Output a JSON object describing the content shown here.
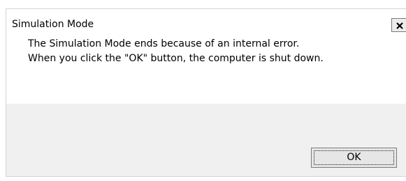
{
  "dialog": {
    "title": "Simulation Mode",
    "close_icon": "close-icon",
    "message_line_1": "The Simulation Mode ends because of an internal error.",
    "message_line_2": "When you click the \"OK\" button, the computer is shut down.",
    "ok_label": "OK"
  }
}
